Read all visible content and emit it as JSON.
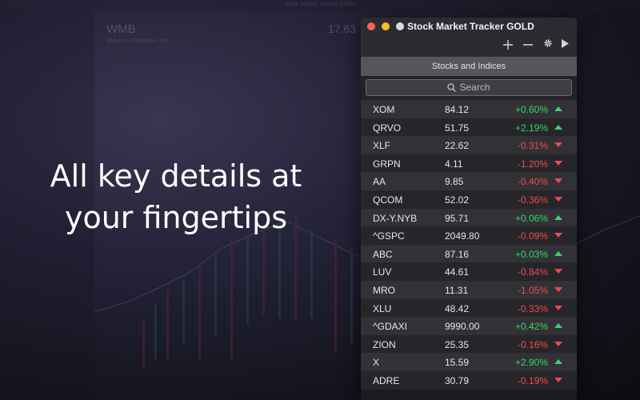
{
  "background_app": {
    "title": "Stock Market Tracker GOLD",
    "symbol": "WMB",
    "company": "Williams Companies, Inc",
    "price": "17.63"
  },
  "headline": {
    "line1": "All key details at",
    "line2": "your fingertips"
  },
  "window": {
    "title": "Stock Market Tracker GOLD",
    "section_title": "Stocks and Indices",
    "search_placeholder": "Search"
  },
  "toolbar": {
    "add_icon": "plus-icon",
    "remove_icon": "minus-icon",
    "settings_icon": "gear-icon",
    "play_icon": "play-icon"
  },
  "colors": {
    "up": "#3ad36b",
    "down": "#ef4a4f",
    "close": "#fd5f57",
    "minimize": "#febc2e"
  },
  "stocks": [
    {
      "symbol": "XOM",
      "price": "84.12",
      "change": "+0.60%",
      "direction": "up"
    },
    {
      "symbol": "QRVO",
      "price": "51.75",
      "change": "+2.19%",
      "direction": "up"
    },
    {
      "symbol": "XLF",
      "price": "22.62",
      "change": "-0.31%",
      "direction": "down"
    },
    {
      "symbol": "GRPN",
      "price": "4.11",
      "change": "-1.20%",
      "direction": "down"
    },
    {
      "symbol": "AA",
      "price": "9.85",
      "change": "-0.40%",
      "direction": "down"
    },
    {
      "symbol": "QCOM",
      "price": "52.02",
      "change": "-0.36%",
      "direction": "down"
    },
    {
      "symbol": "DX-Y.NYB",
      "price": "95.71",
      "change": "+0.06%",
      "direction": "up"
    },
    {
      "symbol": "^GSPC",
      "price": "2049.80",
      "change": "-0.09%",
      "direction": "down"
    },
    {
      "symbol": "ABC",
      "price": "87.16",
      "change": "+0.03%",
      "direction": "up"
    },
    {
      "symbol": "LUV",
      "price": "44.61",
      "change": "-0.84%",
      "direction": "down"
    },
    {
      "symbol": "MRO",
      "price": "11.31",
      "change": "-1.05%",
      "direction": "down"
    },
    {
      "symbol": "XLU",
      "price": "48.42",
      "change": "-0.33%",
      "direction": "down"
    },
    {
      "symbol": "^GDAXI",
      "price": "9990.00",
      "change": "+0.42%",
      "direction": "up"
    },
    {
      "symbol": "ZION",
      "price": "25.35",
      "change": "-0.16%",
      "direction": "down"
    },
    {
      "symbol": "X",
      "price": "15.59",
      "change": "+2.90%",
      "direction": "up"
    },
    {
      "symbol": "ADRE",
      "price": "30.79",
      "change": "-0.19%",
      "direction": "down"
    }
  ]
}
